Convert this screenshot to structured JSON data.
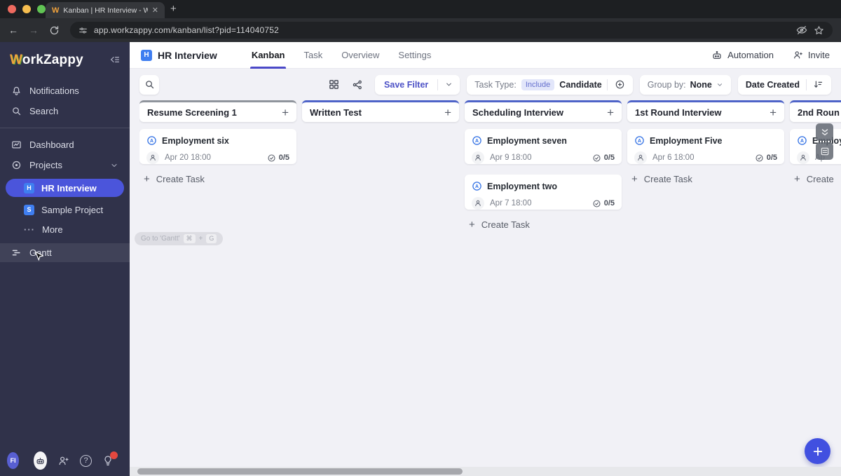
{
  "browser": {
    "favicon": "W",
    "tab_title": "Kanban | HR Interview - Wor",
    "url": "app.workzappy.com/kanban/list?pid=114040752"
  },
  "icons": {
    "close": "✕",
    "new_tab": "+",
    "back": "←",
    "forward": "→",
    "plus": "+",
    "more_dots": "···",
    "question": "?",
    "candidate": "A"
  },
  "sidebar": {
    "logo_first": "W",
    "logo_rest": "orkZappy",
    "notifications": "Notifications",
    "search": "Search",
    "dashboard": "Dashboard",
    "projects": "Projects",
    "hr_initial": "H",
    "hr_label": "HR Interview",
    "sample_initial": "S",
    "sample_label": "Sample Project",
    "more_label": "More",
    "gantt_label": "Gantt",
    "avatar_initials": "FI"
  },
  "header": {
    "project_initial": "H",
    "project_name": "HR Interview",
    "tab_kanban": "Kanban",
    "tab_task": "Task",
    "tab_overview": "Overview",
    "tab_settings": "Settings",
    "automation_label": "Automation",
    "invite_label": "Invite"
  },
  "filter": {
    "save_filter": "Save Filter",
    "task_type_label": "Task Type:",
    "include_chip": "Include",
    "task_type_value": "Candidate",
    "group_by_label": "Group by:",
    "group_by_value": "None",
    "sort_label": "Date Created"
  },
  "tooltip": {
    "text": "Go to 'Gantt'",
    "key_1": "⌘",
    "key_2": "+",
    "key_3": "G"
  },
  "board": {
    "columns": [
      {
        "title": "Resume Screening 1",
        "create_label": "Create Task",
        "cards": [
          {
            "title": "Employment six",
            "date": "Apr 20 18:00",
            "checklist": "0/5"
          }
        ]
      },
      {
        "title": "Written Test",
        "cards": []
      },
      {
        "title": "Scheduling Interview",
        "create_label": "Create Task",
        "cards": [
          {
            "title": "Employment seven",
            "date": "Apr 9 18:00",
            "checklist": "0/5"
          },
          {
            "title": "Employment two",
            "date": "Apr 7 18:00",
            "checklist": "0/5"
          }
        ]
      },
      {
        "title": "1st Round Interview",
        "create_label": "Create Task",
        "cards": [
          {
            "title": "Employment Five",
            "date": "Apr 6 18:00",
            "checklist": "0/5"
          }
        ]
      },
      {
        "title": "2nd Roun",
        "create_label": "Create",
        "cards": [
          {
            "title": "Employ",
            "date": "Ap",
            "checklist": ""
          }
        ]
      }
    ]
  },
  "colors": {
    "brand_orange": "#F2A33C",
    "sidebar_bg": "#30324A",
    "selected_pill_blue": "#4B55DB",
    "project_icon_blue": "#3F7EF0",
    "link_indigo": "#4C51C6",
    "column_accent_blue": "#4E63C8",
    "column_accent_gray": "#8F949C",
    "fab_blue": "#4150E0",
    "notification_red": "#E5483F",
    "candidate_icon_blue": "#2F6FE4"
  }
}
